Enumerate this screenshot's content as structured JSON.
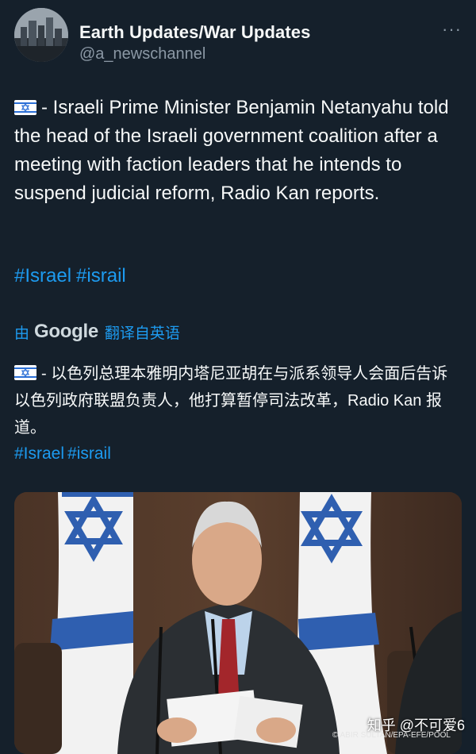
{
  "account": {
    "name": "Earth Updates/War Updates",
    "handle": "@a_newschannel",
    "more_label": "···",
    "avatar_icon": "city-skyline-avatar"
  },
  "post": {
    "flag_icon": "israel-flag-icon",
    "text": "- Israeli Prime Minister Benjamin Netanyahu told the head of the Israeli government coalition after a meeting with faction leaders that he intends to suspend judicial reform, Radio Kan reports.",
    "hashtags": [
      "#Israel",
      "#israil"
    ]
  },
  "translation": {
    "by_label": "由",
    "provider": "Google",
    "link_label": "翻译自英语",
    "text": "- 以色列总理本雅明内塔尼亚胡在与派系领导人会面后告诉以色列政府联盟负责人，他打算暂停司法改革，Radio Kan 报道。",
    "hashtags": [
      "#Israel",
      "#israil"
    ]
  },
  "media": {
    "caption": "© ABIR SULTAN/EPA-EFE/POOL",
    "watermark": "知乎 @不可爱6"
  },
  "colors": {
    "background": "#15202b",
    "text": "#f7f9f9",
    "muted": "#8b98a5",
    "link": "#1d9bf0"
  }
}
